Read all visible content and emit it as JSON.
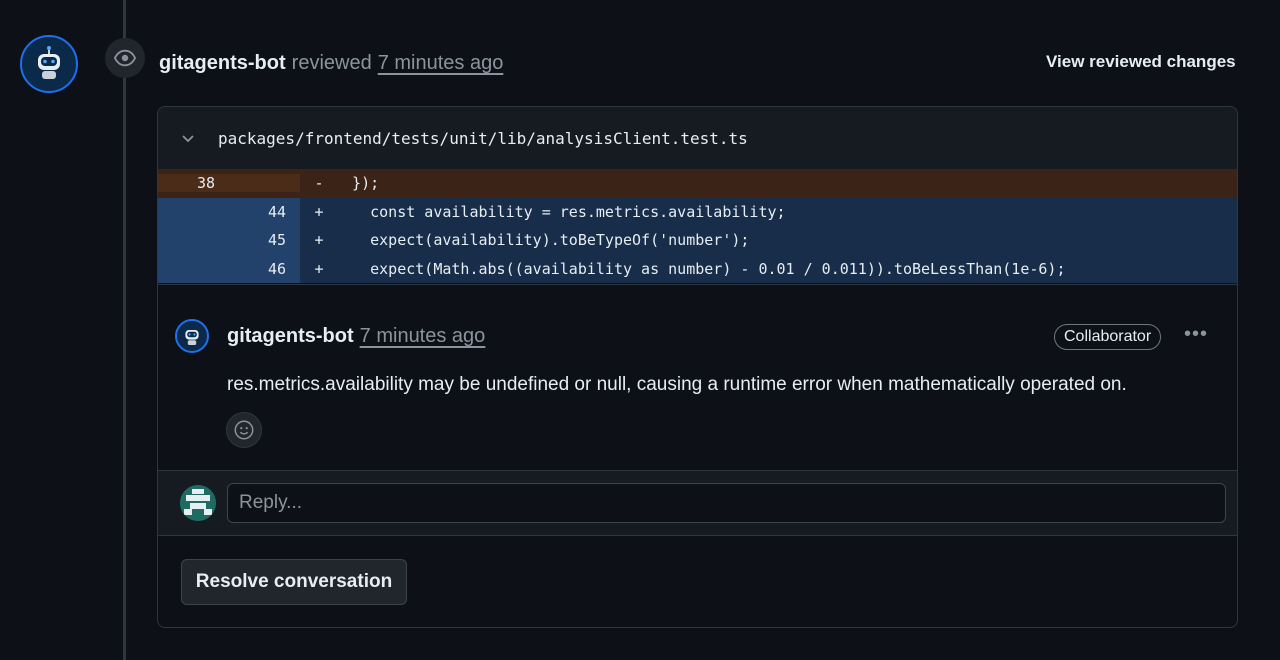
{
  "review": {
    "author": "gitagents-bot",
    "action": "reviewed",
    "time": "7 minutes ago",
    "view_changes_label": "View reviewed changes"
  },
  "file": {
    "path": "packages/frontend/tests/unit/lib/analysisClient.test.ts"
  },
  "diff": {
    "lines": [
      {
        "type": "del",
        "old": "38",
        "new": "",
        "marker": "-",
        "code": "  });"
      },
      {
        "type": "add",
        "old": "",
        "new": "44",
        "marker": "+",
        "code": "    const availability = res.metrics.availability;"
      },
      {
        "type": "add",
        "old": "",
        "new": "45",
        "marker": "+",
        "code": "    expect(availability).toBeTypeOf('number');"
      },
      {
        "type": "add",
        "old": "",
        "new": "46",
        "marker": "+",
        "code": "    expect(Math.abs((availability as number) - 0.01 / 0.011)).toBeLessThan(1e-6);"
      }
    ]
  },
  "comment": {
    "author": "gitagents-bot",
    "time": "7 minutes ago",
    "badge": "Collaborator",
    "menu": "•••",
    "body": "res.metrics.availability may be undefined or null, causing a runtime error when mathematically operated on."
  },
  "reply": {
    "placeholder": "Reply..."
  },
  "resolve_label": "Resolve conversation",
  "icons": {
    "eye": "eye-icon",
    "chevron": "chevron-down-icon",
    "smiley": "smiley-icon",
    "kebab": "kebab-horizontal-icon"
  },
  "colors": {
    "background": "#0d1117",
    "deletion": "#3b2417",
    "addition": "#172d4a",
    "accent": "#1f6feb"
  }
}
